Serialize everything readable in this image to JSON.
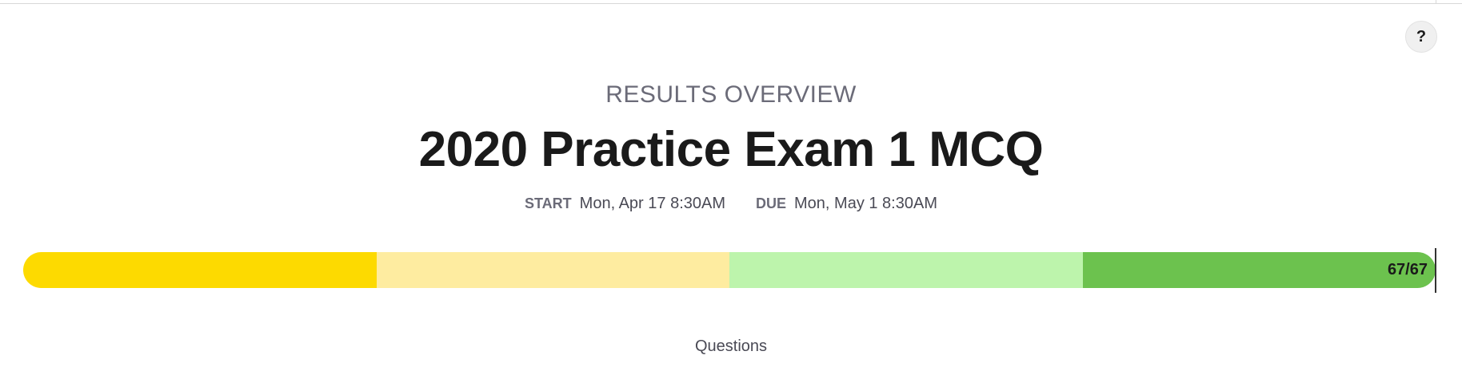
{
  "help": {
    "label": "?"
  },
  "header": {
    "overline": "RESULTS OVERVIEW",
    "title": "2020 Practice Exam 1 MCQ"
  },
  "dates": {
    "start_label": "START",
    "start_value": "Mon, Apr 17 8:30AM",
    "due_label": "DUE",
    "due_value": "Mon, May 1 8:30AM"
  },
  "progress": {
    "count_label": "67/67",
    "completed": 67,
    "total": 67,
    "segments": [
      {
        "color": "#fdda00",
        "fraction": 0.25
      },
      {
        "color": "#feeca0",
        "fraction": 0.25
      },
      {
        "color": "#bdf4ac",
        "fraction": 0.25
      },
      {
        "color": "#6cc24e",
        "fraction": 0.25
      }
    ]
  },
  "questions": {
    "label": "Questions"
  }
}
